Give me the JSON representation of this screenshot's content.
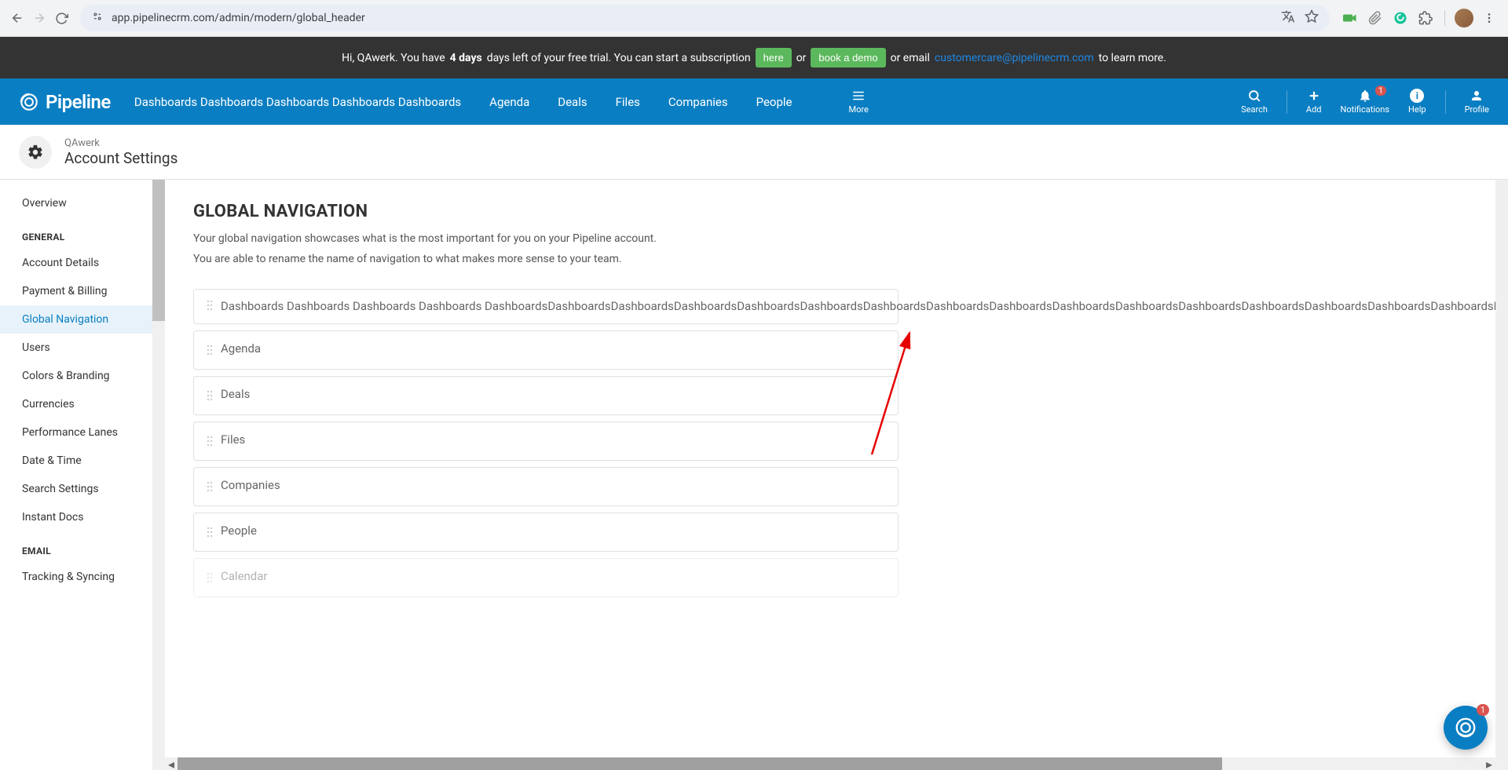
{
  "browser": {
    "url": "app.pipelinecrm.com/admin/modern/global_header"
  },
  "trial": {
    "preBold": "Hi, QAwerk. You have ",
    "bold": "4 days",
    "postBold": " days left of your free trial. You can start a subscription ",
    "hereBtn": "here",
    "or": " or ",
    "demoBtn": "book a demo",
    "orEmail": " or email ",
    "email": "customercare@pipelinecrm.com",
    "learnMore": " to learn more."
  },
  "appName": "Pipeline",
  "topNav": {
    "items": [
      "Dashboards Dashboards Dashboards Dashboards Dashboards",
      "Agenda",
      "Deals",
      "Files",
      "Companies",
      "People"
    ],
    "more": "More",
    "right": {
      "search": "Search",
      "add": "Add",
      "notifications": "Notifications",
      "notificationsBadge": "1",
      "help": "Help",
      "profile": "Profile"
    }
  },
  "settingsHeader": {
    "user": "QAwerk",
    "title": "Account Settings"
  },
  "sidebar": {
    "items": [
      {
        "label": "Overview",
        "type": "item"
      },
      {
        "label": "GENERAL",
        "type": "section"
      },
      {
        "label": "Account Details",
        "type": "item"
      },
      {
        "label": "Payment & Billing",
        "type": "item"
      },
      {
        "label": "Global Navigation",
        "type": "item",
        "active": true
      },
      {
        "label": "Users",
        "type": "item"
      },
      {
        "label": "Colors & Branding",
        "type": "item"
      },
      {
        "label": "Currencies",
        "type": "item"
      },
      {
        "label": "Performance Lanes",
        "type": "item"
      },
      {
        "label": "Date & Time",
        "type": "item"
      },
      {
        "label": "Search Settings",
        "type": "item"
      },
      {
        "label": "Instant Docs",
        "type": "item"
      },
      {
        "label": "EMAIL",
        "type": "section"
      },
      {
        "label": "Tracking & Syncing",
        "type": "item"
      }
    ]
  },
  "main": {
    "title": "GLOBAL NAVIGATION",
    "desc1": "Your global navigation showcases what is the most important for you on your Pipeline account.",
    "desc2": "You are able to rename the name of navigation to what makes more sense to your team.",
    "cards": [
      "Dashboards Dashboards Dashboards Dashboards DashboardsDashboardsDashboardsDashboardsDashboardsDashboardsDashboardsDashboardsDashboardsDashboardsDashboardsDashboardsDashboardsDashboardsDashboardsDashboardsDashboardsDashboards",
      "Agenda",
      "Deals",
      "Files",
      "Companies",
      "People",
      "Calendar"
    ]
  },
  "chat": {
    "badge": "1"
  }
}
